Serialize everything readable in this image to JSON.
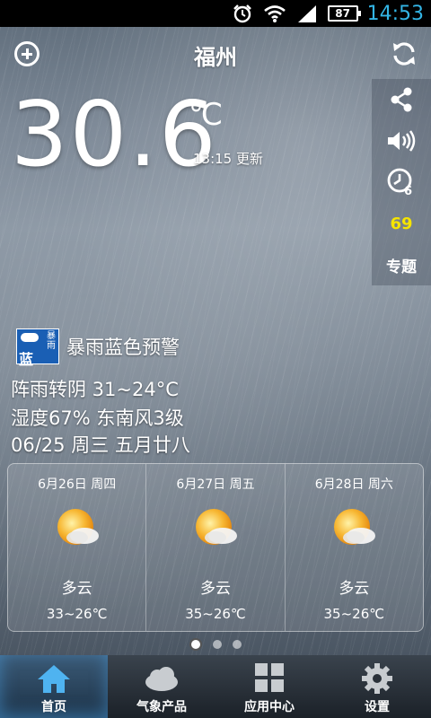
{
  "status_bar": {
    "battery": "87",
    "time": "14:53"
  },
  "header": {
    "city": "福州"
  },
  "side_panel": {
    "aqi_value": "69",
    "topic_label": "专题"
  },
  "current": {
    "temperature": "30.6",
    "unit": "℃",
    "update_time": "13:15 更新"
  },
  "warning": {
    "icon_char": "蓝",
    "icon_small_text": "暴\n雨",
    "label": "暴雨蓝色预警"
  },
  "conditions": {
    "weather_temp": "阵雨转阴  31~24°C",
    "humidity_wind": "湿度67%  东南风3级",
    "date_line": "06/25  周三  五月廿八"
  },
  "forecast": [
    {
      "date": "6月26日 周四",
      "desc": "多云",
      "temp": "33~26℃",
      "icon": "sun-cloud-icon"
    },
    {
      "date": "6月27日 周五",
      "desc": "多云",
      "temp": "35~26℃",
      "icon": "sun-cloud-icon"
    },
    {
      "date": "6月28日 周六",
      "desc": "多云",
      "temp": "35~26℃",
      "icon": "sun-cloud-icon"
    }
  ],
  "pager": {
    "active_index": 0,
    "count": 3
  },
  "bottom_nav": [
    {
      "label": "首页",
      "icon": "home-icon",
      "active": true
    },
    {
      "label": "气象产品",
      "icon": "cloud-icon",
      "active": false
    },
    {
      "label": "应用中心",
      "icon": "grid-icon",
      "active": false
    },
    {
      "label": "设置",
      "icon": "gear-icon",
      "active": false
    }
  ],
  "colors": {
    "clock": "#33b5e5",
    "aqi": "#f5e400",
    "warning_blue": "#1a5fb4"
  }
}
